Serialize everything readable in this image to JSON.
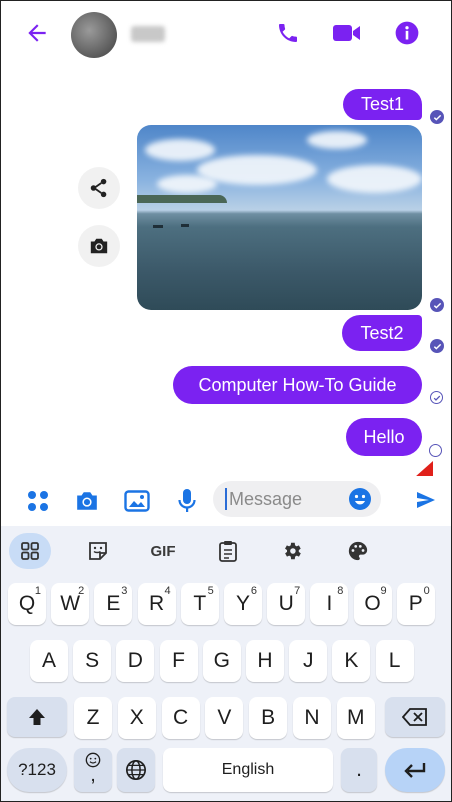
{
  "header": {
    "back_icon": "arrow-left-icon",
    "call_icon": "phone-icon",
    "video_icon": "video-icon",
    "info_icon": "info-icon",
    "accent_color": "#7b22f1"
  },
  "messages": [
    {
      "text": "Test1",
      "status": "seen"
    },
    {
      "type": "photo",
      "status": "seen"
    },
    {
      "text": "Test2",
      "status": "seen"
    },
    {
      "text": "Computer How-To Guide",
      "status": "delivered"
    },
    {
      "text": "Hello",
      "status": "sending"
    }
  ],
  "photo_actions": [
    "share-icon",
    "camera-icon"
  ],
  "composer": {
    "placeholder": "Message",
    "icons": [
      "apps-grid-icon",
      "camera-icon",
      "image-icon",
      "microphone-icon",
      "emoji-icon",
      "send-icon"
    ]
  },
  "keyboard": {
    "toolbar": {
      "gif_label": "GIF"
    },
    "rows": [
      [
        {
          "k": "Q",
          "s": "1"
        },
        {
          "k": "W",
          "s": "2"
        },
        {
          "k": "E",
          "s": "3"
        },
        {
          "k": "R",
          "s": "4"
        },
        {
          "k": "T",
          "s": "5"
        },
        {
          "k": "Y",
          "s": "6"
        },
        {
          "k": "U",
          "s": "7"
        },
        {
          "k": "I",
          "s": "8"
        },
        {
          "k": "O",
          "s": "9"
        },
        {
          "k": "P",
          "s": "0"
        }
      ],
      [
        {
          "k": "A"
        },
        {
          "k": "S"
        },
        {
          "k": "D"
        },
        {
          "k": "F"
        },
        {
          "k": "G"
        },
        {
          "k": "H"
        },
        {
          "k": "J"
        },
        {
          "k": "K"
        },
        {
          "k": "L"
        }
      ],
      [
        {
          "k": "Z"
        },
        {
          "k": "X"
        },
        {
          "k": "C"
        },
        {
          "k": "V"
        },
        {
          "k": "B"
        },
        {
          "k": "N"
        },
        {
          "k": "M"
        }
      ]
    ],
    "symbols_label": "?123",
    "space_label": "English",
    "period_label": ".",
    "comma_label": ","
  },
  "annotation": {
    "arrow_color": "#e0201a"
  }
}
